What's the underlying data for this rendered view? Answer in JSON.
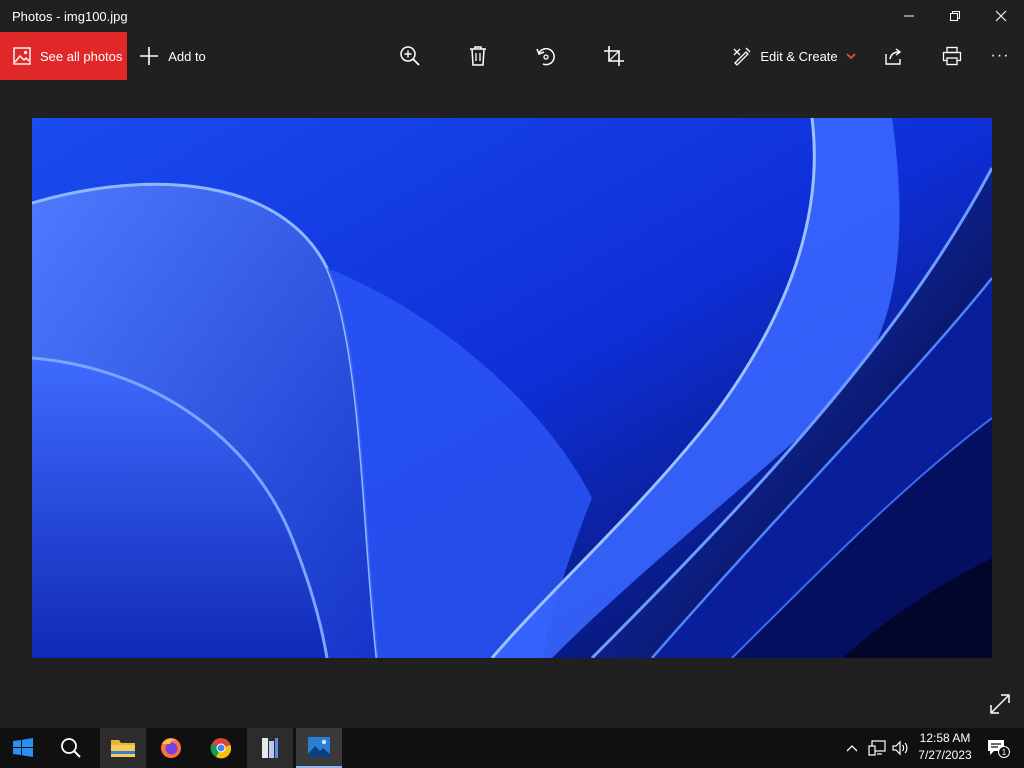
{
  "window": {
    "title": "Photos - img100.jpg"
  },
  "toolbar": {
    "see_all_label": "See all photos",
    "add_to_label": "Add to",
    "edit_create_label": "Edit & Create",
    "more_label": "···"
  },
  "taskbar": {
    "time": "12:58 AM",
    "date": "7/27/2023",
    "notification_count": "1"
  },
  "colors": {
    "accent_red": "#e12828",
    "chevron_red": "#e74c3c"
  }
}
